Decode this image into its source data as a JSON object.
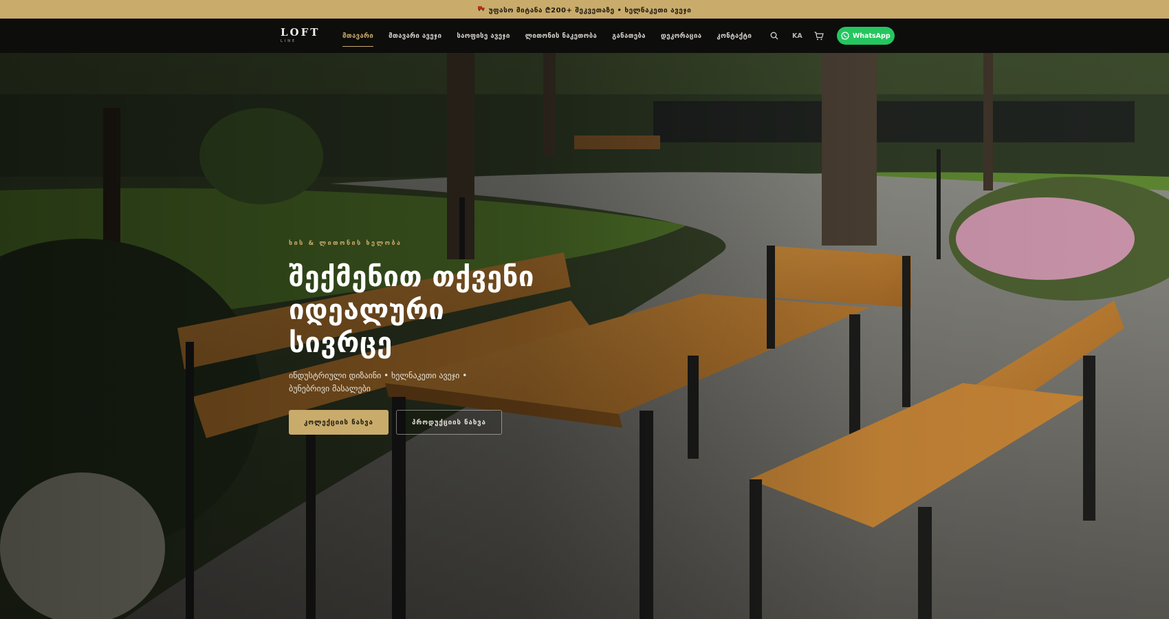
{
  "promo": {
    "truck_icon": "truck-icon",
    "text": "უფასო მიტანა ₾200+ შეკვეთაზე  •  ხელნაკეთი ავეჯი"
  },
  "nav": {
    "logo_main": "LOFT",
    "logo_sub": "LINE",
    "items": [
      {
        "label": "მთავარი",
        "active": true
      },
      {
        "label": "მთავარი ავეჯი"
      },
      {
        "label": "საოფისე ავეჯი"
      },
      {
        "label": "ლითონის ნაკეთობა"
      },
      {
        "label": "განათება"
      },
      {
        "label": "დეკორაცია"
      },
      {
        "label": "კონტაქტი"
      }
    ],
    "search_icon": "search-icon",
    "lang": "KA",
    "cart_icon": "cart-icon",
    "whatsapp_label": "WhatsApp"
  },
  "hero": {
    "kicker": "ხის & ლითონის ხელობა",
    "headline_lines": [
      "შექმენით თქვენი",
      "იდეალური",
      "სივრცე"
    ],
    "subline": "ინდუსტრიული დიზაინი • ხელნაკეთი ავეჯი • ბუნებრივი მასალები",
    "primary_button": "კოლექციის ნახვა",
    "secondary_button": "პროდუქციის ნახვა"
  },
  "colors": {
    "accent": "#c9ab6b",
    "nav_bg": "#0d0d0c",
    "whatsapp": "#25c65f"
  }
}
